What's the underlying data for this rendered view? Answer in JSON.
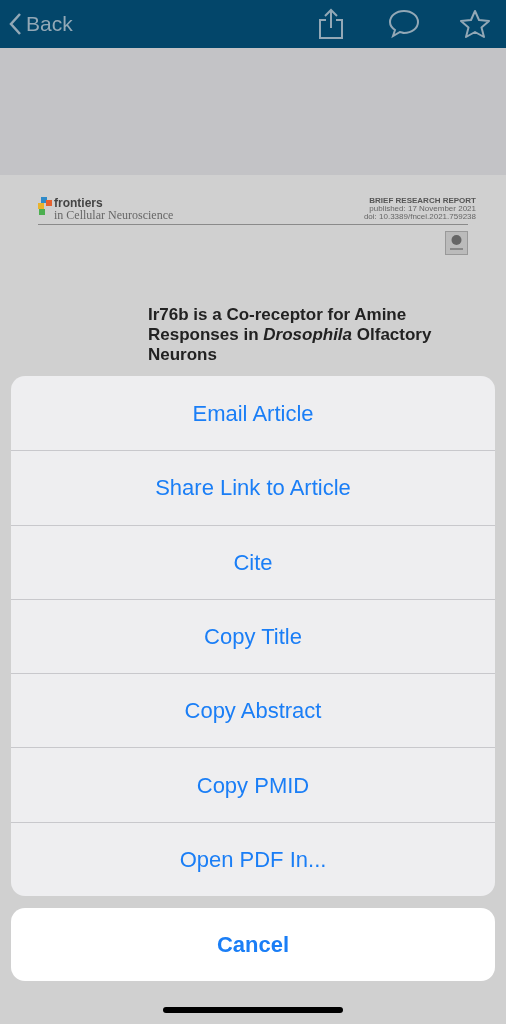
{
  "nav_bar": {
    "back": "Back"
  },
  "document": {
    "journal": "frontiers",
    "journal_subtitle": "in Cellular Neuroscience",
    "report_type": "BRIEF RESEARCH REPORT",
    "published": "published: 17 November 2021",
    "doi": "doi: 10.3389/fncel.2021.759238",
    "title": "Ir76b is a Co-receptor for Amine Responses in *Drosophila* Olfactory Neurons"
  },
  "action_sheet": {
    "actions": [
      "Email Article",
      "Share Link to Article",
      "Cite",
      "Copy Title",
      "Copy Abstract",
      "Copy PMID",
      "Open PDF In..."
    ],
    "cancel": "Cancel"
  }
}
